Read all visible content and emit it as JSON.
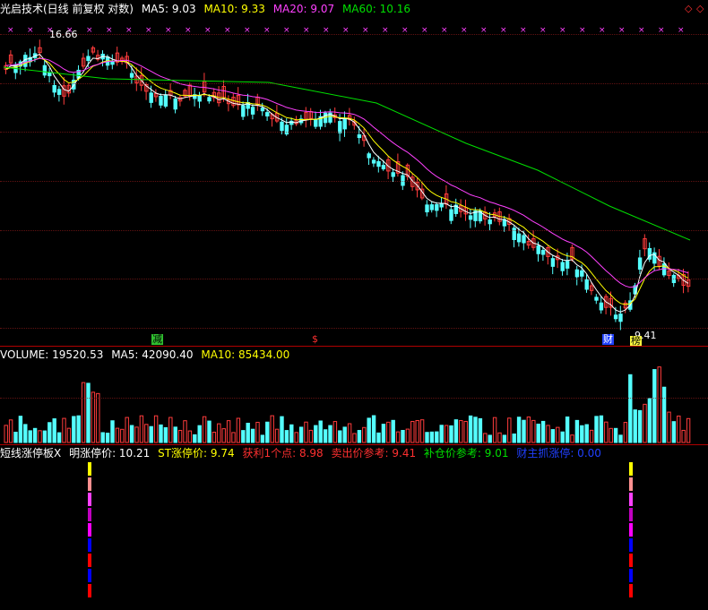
{
  "header": {
    "title": "光启技术(日线 前复权 对数)",
    "ma5": "MA5: 9.03",
    "ma10": "MA10: 9.33",
    "ma20": "MA20: 9.07",
    "ma60": "MA60: 10.16"
  },
  "price_panel": {
    "high_label": "16.66",
    "low_label": "9.41",
    "marker_jian": "减",
    "marker_s": "$",
    "marker_cai": "财",
    "marker_bang": "榜"
  },
  "volume_header": {
    "volume": "VOLUME: 19520.53",
    "ma5": "MA5: 42090.40",
    "ma10": "MA10: 85434.00"
  },
  "indicator_header": {
    "name": "短线涨停板X",
    "ming": "明涨停价: 10.21",
    "st": "ST涨停价: 9.74",
    "profit": "获利1个点: 8.98",
    "sell": "卖出价参考: 9.41",
    "add": "补仓价参考: 9.01",
    "cai": "财主抓涨停: 0.00"
  },
  "colors": {
    "background": "#000000",
    "up_candle": "#ff3c3c",
    "down_candle": "#54ffff",
    "ma5": "#ffffff",
    "ma10": "#ffff00",
    "ma20": "#ff40ff",
    "ma60": "#00e000",
    "grid": "#8a1a1a"
  },
  "icons": [
    "diamond-outline-icon",
    "diamond-outline-icon"
  ]
}
